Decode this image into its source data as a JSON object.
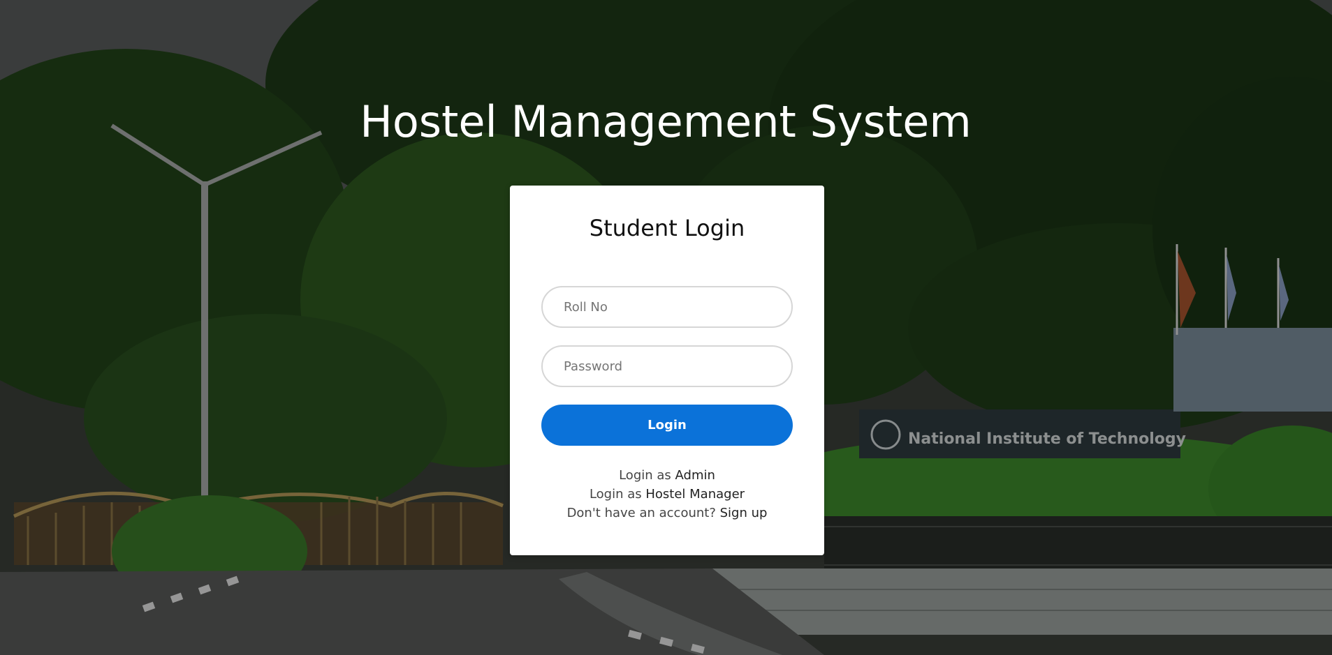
{
  "page": {
    "title": "Hostel Management System"
  },
  "login_card": {
    "heading": "Student Login",
    "roll_placeholder": "Roll No",
    "password_placeholder": "Password",
    "login_button": "Login"
  },
  "links": {
    "admin_prefix": "Login as ",
    "admin_link": "Admin",
    "manager_prefix": "Login as ",
    "manager_link": "Hostel Manager",
    "signup_prefix": "Don't have an account? ",
    "signup_link": "Sign up"
  },
  "background": {
    "sign_text": "National Institute of Technology"
  },
  "colors": {
    "primary_button": "#0b72d9",
    "card_bg": "#ffffff",
    "title_text": "#ffffff"
  }
}
